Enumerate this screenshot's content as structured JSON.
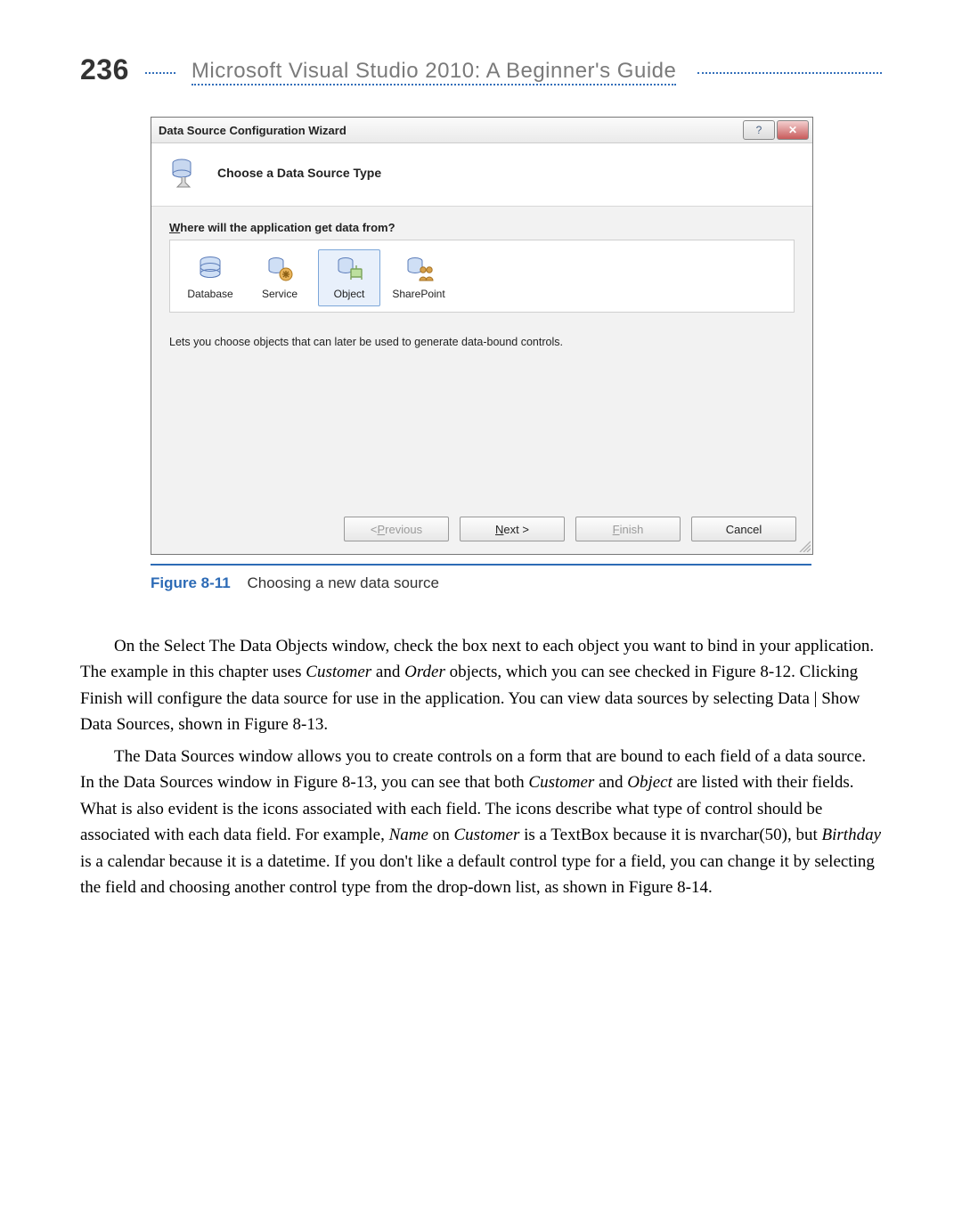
{
  "page": {
    "number": "236",
    "running_title": "Microsoft Visual Studio 2010: A Beginner's Guide"
  },
  "wizard": {
    "title": "Data Source Configuration Wizard",
    "help_glyph": "?",
    "close_glyph": "✕",
    "heading": "Choose a Data Source Type",
    "question_pre": "W",
    "question_post": "here will the application get data from?",
    "options": {
      "database": "Database",
      "service": "Service",
      "object": "Object",
      "sharepoint": "SharePoint"
    },
    "selected": "object",
    "description": "Lets you choose objects that can later be used to generate data-bound controls.",
    "buttons": {
      "previous_pre": "< ",
      "previous_u": "P",
      "previous_post": "revious",
      "next_u": "N",
      "next_post": "ext >",
      "finish_u": "F",
      "finish_post": "inish",
      "cancel": "Cancel"
    }
  },
  "caption": {
    "figno": "Figure 8-11",
    "text": "Choosing a new data source"
  },
  "body": {
    "p1_a": "On the Select The Data Objects window, check the box next to each object you want to bind in your application. The example in this chapter uses ",
    "p1_em1": "Customer",
    "p1_b": " and ",
    "p1_em2": "Order",
    "p1_c": " objects, which you can see checked in Figure 8-12. Clicking Finish will configure the data source for use in the application. You can view data sources by selecting Data | Show Data Sources, shown in Figure 8-13.",
    "p2_a": "The Data Sources window allows you to create controls on a form that are bound to each field of a data source. In the Data Sources window in Figure 8-13, you can see that both ",
    "p2_em1": "Customer",
    "p2_b": " and ",
    "p2_em2": "Object",
    "p2_c": " are listed with their fields. What is also evident is the icons associated with each field. The icons describe what type of control should be associated with each data field. For example, ",
    "p2_em3": "Name",
    "p2_d": " on ",
    "p2_em4": "Customer",
    "p2_e": " is a TextBox because it is nvarchar(50), but ",
    "p2_em5": "Birthday",
    "p2_f": " is a calendar because it is a datetime. If you don't like a default control type for a field, you can change it by selecting the field and choosing another control type from the drop-down list, as shown in Figure 8-14."
  }
}
